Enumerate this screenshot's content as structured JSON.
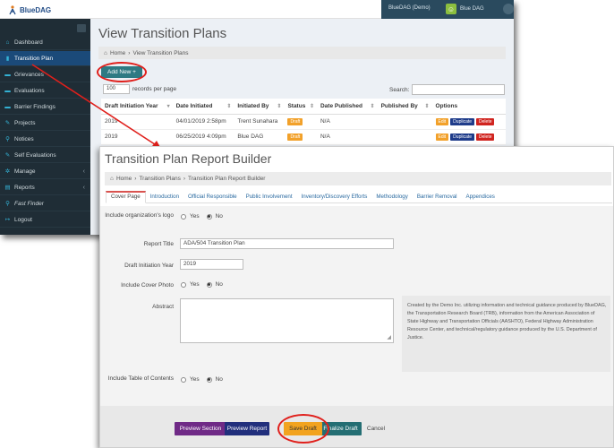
{
  "app": {
    "logo_text": "BlueDAG",
    "org_name": "BlueDAG (Demo)",
    "user_name": "Blue DAG"
  },
  "sidebar": {
    "items": [
      {
        "label": "Dashboard",
        "icon": "dashboard-icon",
        "glyph": "⌂"
      },
      {
        "label": "Transition Plan",
        "icon": "document-icon",
        "glyph": "▮"
      },
      {
        "label": "Grievances",
        "icon": "list-icon",
        "glyph": "▬"
      },
      {
        "label": "Evaluations",
        "icon": "list-icon",
        "glyph": "▬"
      },
      {
        "label": "Barrier Findings",
        "icon": "list-icon",
        "glyph": "▬"
      },
      {
        "label": "Projects",
        "icon": "wrench-icon",
        "glyph": "✎"
      },
      {
        "label": "Notices",
        "icon": "pin-icon",
        "glyph": "⚲"
      },
      {
        "label": "Self Evaluations",
        "icon": "edit-icon",
        "glyph": "✎"
      },
      {
        "label": "Manage",
        "icon": "gear-icon",
        "glyph": "✲"
      },
      {
        "label": "Reports",
        "icon": "chart-icon",
        "glyph": "▤"
      },
      {
        "label": "Fast Finder",
        "icon": "search-icon",
        "glyph": "⚲"
      },
      {
        "label": "Logout",
        "icon": "logout-icon",
        "glyph": "↦"
      }
    ]
  },
  "list_page": {
    "title": "View Transition Plans",
    "breadcrumb": [
      "Home",
      "View Transition Plans"
    ],
    "add_button": "Add New +",
    "page_size": "100",
    "page_size_label": "records per page",
    "search_label": "Search:",
    "columns": [
      "Draft Initiation Year",
      "Date Initiated",
      "Initiated By",
      "Status",
      "Date Published",
      "Published By",
      "Options"
    ],
    "rows": [
      {
        "year": "2019",
        "date": "04/01/2019 2:58pm",
        "by": "Trent Sunahara",
        "status": "Draft",
        "published": "N/A",
        "published_by": ""
      },
      {
        "year": "2019",
        "date": "06/25/2019 4:09pm",
        "by": "Blue DAG",
        "status": "Draft",
        "published": "N/A",
        "published_by": ""
      }
    ],
    "row_actions": [
      "Edit",
      "Duplicate",
      "Delete"
    ]
  },
  "builder": {
    "title": "Transition Plan Report Builder",
    "breadcrumb": [
      "Home",
      "Transition Plans",
      "Transition Plan Report Builder"
    ],
    "tabs": [
      "Cover Page",
      "Introduction",
      "Official Responsible",
      "Public Involvement",
      "Inventory/Discovery Efforts",
      "Methodology",
      "Barrier Removal",
      "Appendices"
    ],
    "fields": {
      "include_logo_label": "Include organization's logo",
      "yes": "Yes",
      "no": "No",
      "report_title_label": "Report Title",
      "report_title_value": "ADA/504 Transition Plan",
      "draft_year_label": "Draft Initiation Year",
      "draft_year_value": "2019",
      "cover_photo_label": "Include Cover Photo",
      "abstract_label": "Abstract",
      "abstract_hint": "Created by the Demo Inc. utilizing information and technical guidance produced by BlueDAG, the Transportation Research Board (TRB), information from the American Association of State Highway and Transportation Officials (AASHTO), Federal Highway Administration Resource Center, and technical/regulatory guidance produced by the U.S. Department of Justice.",
      "toc_label": "Include Table of Contents"
    },
    "buttons": {
      "preview_section": "Preview Section",
      "preview_report": "Preview Report",
      "save_draft": "Save Draft",
      "finalize_draft": "Finalize Draft",
      "cancel": "Cancel"
    }
  },
  "colors": {
    "sidebar_bg": "#1f2d36",
    "sidebar_active": "#1b4a79",
    "add_button": "#2e7a83",
    "highlight_circle": "#e0201c",
    "save_draft": "#f2a31f",
    "preview_section": "#6f2a86",
    "preview_report": "#212f7c",
    "finalize": "#246e73"
  }
}
